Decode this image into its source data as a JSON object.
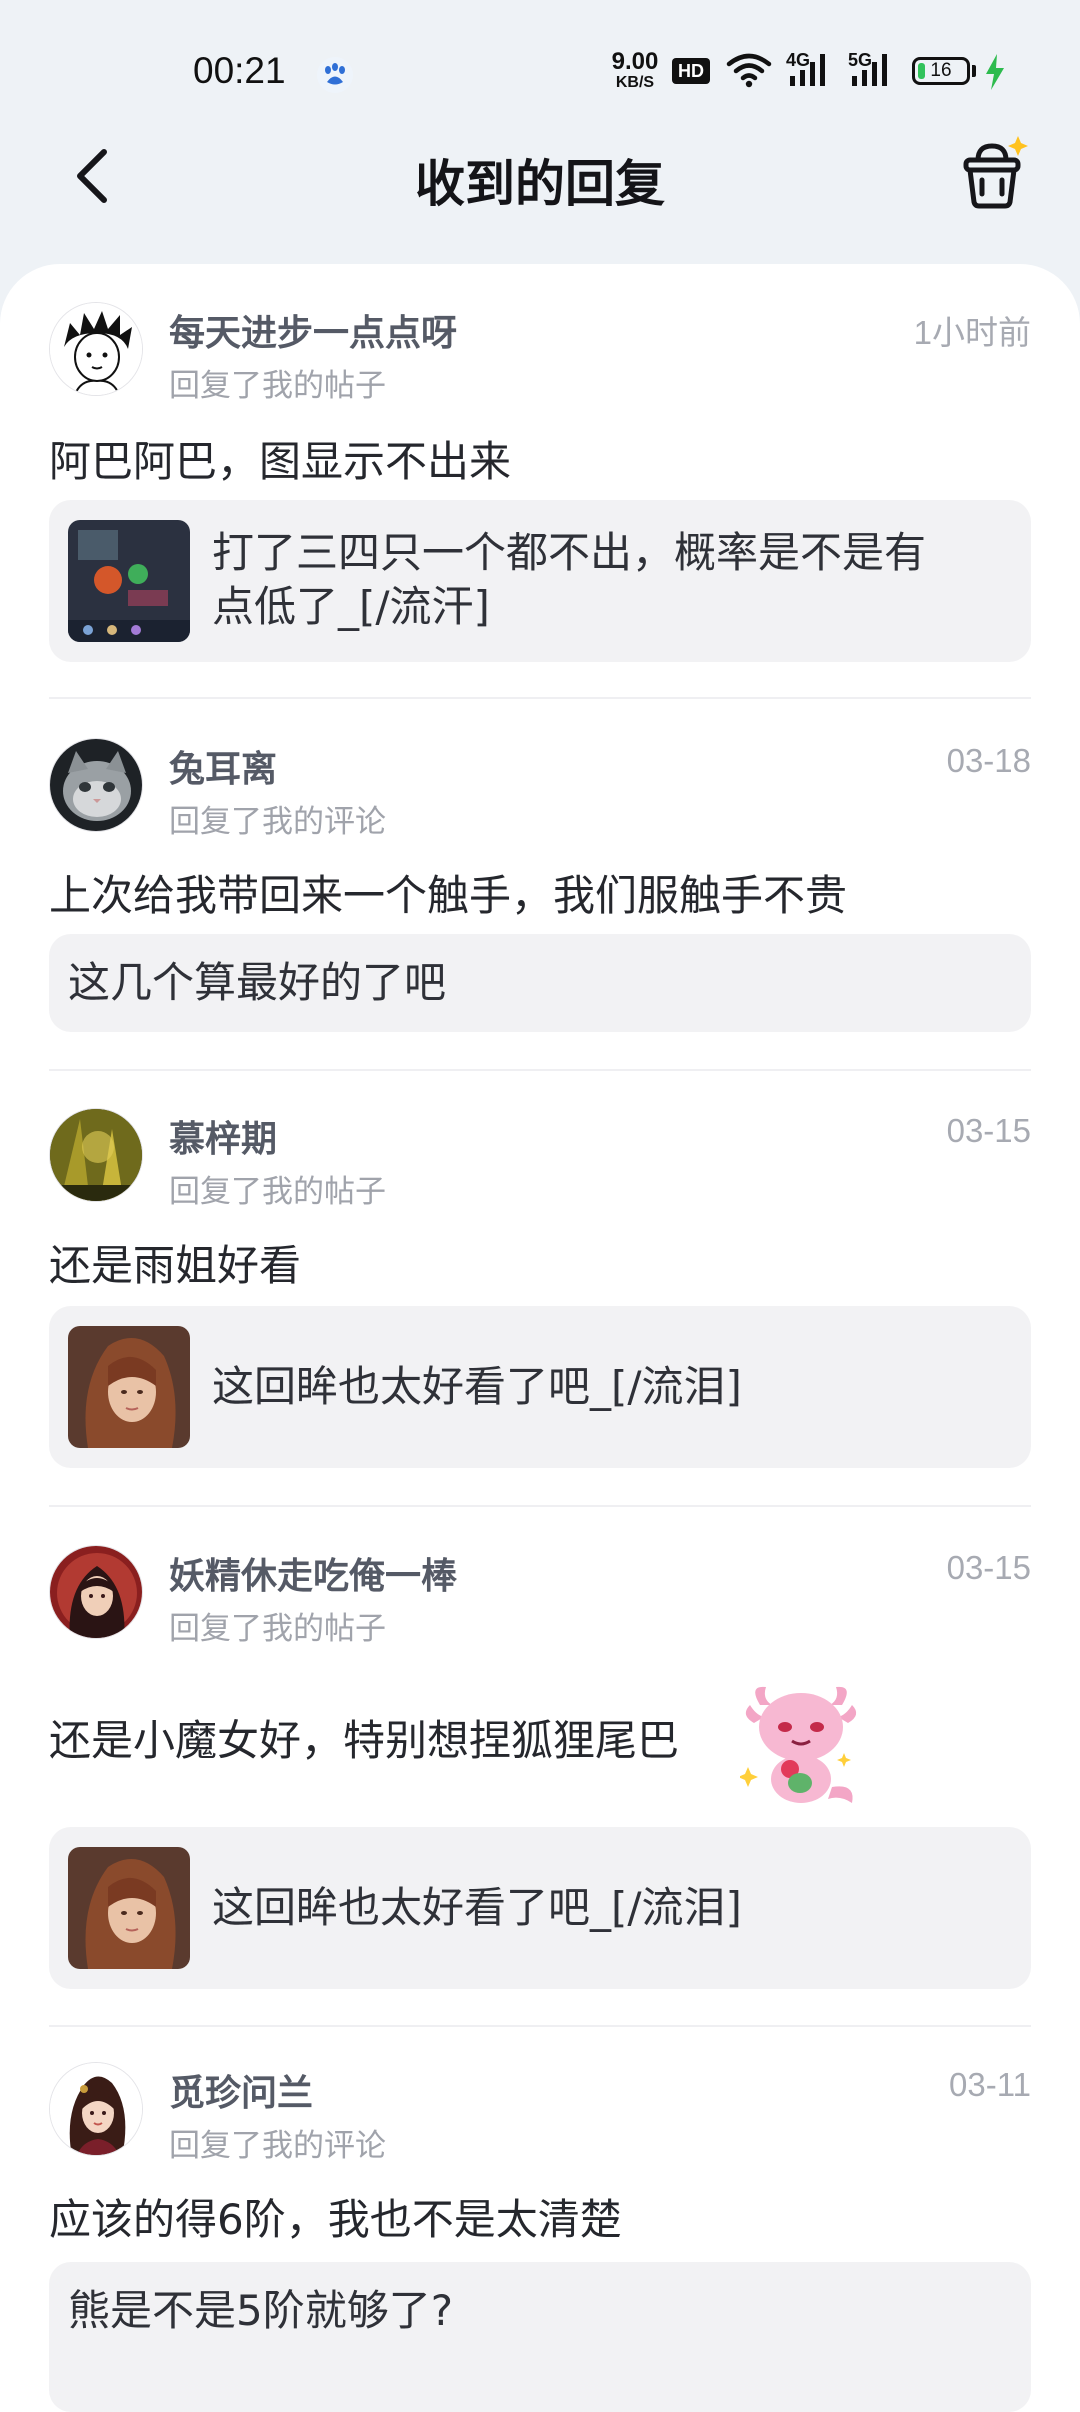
{
  "status_bar": {
    "time": "00:21",
    "app_icon": "paw-icon",
    "net_speed_value": "9.00",
    "net_speed_unit": "KB/S",
    "hd_label": "HD",
    "sig1_label": "4G",
    "sig2_label": "5G",
    "battery": "16",
    "battery_level": 0.16,
    "charging": true
  },
  "nav": {
    "title": "收到的回复",
    "back_icon": "chevron-left-icon",
    "cart_icon": "shopping-basket-icon"
  },
  "items": [
    {
      "username": "每天进步一点点呀",
      "subtitle": "回复了我的帖子",
      "time": "1小时前",
      "reply": "阿巴阿巴，图显示不出来",
      "quote_line1": "打了三四只一个都不出，概率是不是有",
      "quote_line2": "点低了_[/流汗]"
    },
    {
      "username": "兔耳离",
      "subtitle": "回复了我的评论",
      "time": "03-18",
      "reply": "上次给我带回来一个触手，我们服触手不贵",
      "quote": "这几个算最好的了吧"
    },
    {
      "username": "慕梓期",
      "subtitle": "回复了我的帖子",
      "time": "03-15",
      "reply": "还是雨姐好看",
      "quote": "这回眸也太好看了吧_[/流泪]"
    },
    {
      "username": "妖精休走吃俺一棒",
      "subtitle": "回复了我的帖子",
      "time": "03-15",
      "reply": "还是小魔女好，特别想捏狐狸尾巴",
      "quote": "这回眸也太好看了吧_[/流泪]"
    },
    {
      "username": "觅珍问兰",
      "subtitle": "回复了我的评论",
      "time": "03-11",
      "reply": "应该的得6阶，我也不是太清楚",
      "quote": "熊是不是5阶就够了?"
    }
  ]
}
